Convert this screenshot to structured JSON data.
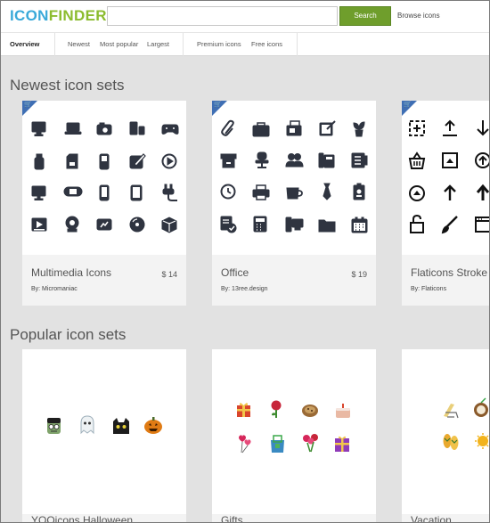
{
  "header": {
    "logo_part1": "ICON",
    "logo_part2": "FINDER",
    "search_placeholder": "",
    "search_button": "Search",
    "browse_link": "Browse icons"
  },
  "nav": {
    "overview": "Overview",
    "newest": "Newest",
    "most_popular": "Most popular",
    "largest": "Largest",
    "premium": "Premium icons",
    "free": "Free icons"
  },
  "sections": {
    "newest_title": "Newest icon sets",
    "popular_title": "Popular icon sets"
  },
  "newest_sets": [
    {
      "name": "Multimedia Icons",
      "price": "$ 14",
      "author": "By: Micromaniac",
      "premium": true,
      "icons": [
        "monitor-icon",
        "laptop-icon",
        "camera-icon",
        "media-player-icon",
        "gamepad-icon",
        "usb-drive-icon",
        "sd-card-icon",
        "mp3-player-icon",
        "graphics-tablet-icon",
        "play-circle-icon",
        "display-icon",
        "handheld-console-icon",
        "smartphone-icon",
        "tablet-icon",
        "plug-icon",
        "video-player-icon",
        "webcam-icon",
        "digital-frame-icon",
        "disc-icon",
        "box-3d-icon"
      ]
    },
    {
      "name": "Office",
      "price": "$ 19",
      "author": "By: 13ree.design",
      "premium": true,
      "icons": [
        "paperclip-icon",
        "briefcase-icon",
        "fax-icon",
        "notes-icon",
        "plant-icon",
        "inbox-tray-icon",
        "office-chair-icon",
        "users-icon",
        "phone-icon",
        "rolodex-icon",
        "clock-icon",
        "printer-icon",
        "coffee-cup-icon",
        "tie-icon",
        "id-badge-icon",
        "document-check-icon",
        "calculator-icon",
        "computer-icon",
        "folder-icon",
        "calendar-icon"
      ]
    },
    {
      "name": "Flaticons Stroke",
      "price": "",
      "author": "By: Flaticons",
      "premium": true,
      "icons": [
        "add-square-icon",
        "upload-icon",
        "arrow-down-icon",
        "basket-icon",
        "up-square-icon",
        "up-circle-icon",
        "up-circle-solid-icon",
        "arrow-up-icon",
        "arrow-up-bold-icon",
        "unlock-icon",
        "brush-icon",
        "window-icon"
      ]
    }
  ],
  "popular_sets": [
    {
      "name": "YOOicons Halloween",
      "icons": [
        "frankenstein-icon",
        "ghost-icon",
        "black-cat-icon",
        "pumpkin-icon"
      ]
    },
    {
      "name": "Gifts",
      "icons": [
        "gift-box-icon",
        "rose-icon",
        "cookie-icon",
        "cake-icon",
        "heart-balloons-icon",
        "gift-bag-icon",
        "flowers-icon",
        "present-icon"
      ]
    },
    {
      "name": "Vacation",
      "icons": [
        "beach-chair-icon",
        "coconut-icon",
        "flip-flops-icon",
        "sun-icon"
      ]
    }
  ],
  "colors": {
    "brand_blue": "#39a9d9",
    "brand_green": "#8cbc2f",
    "search_button": "#6f9e2c",
    "premium_corner": "#3f6fb4",
    "icon_dark": "#2f3440"
  }
}
